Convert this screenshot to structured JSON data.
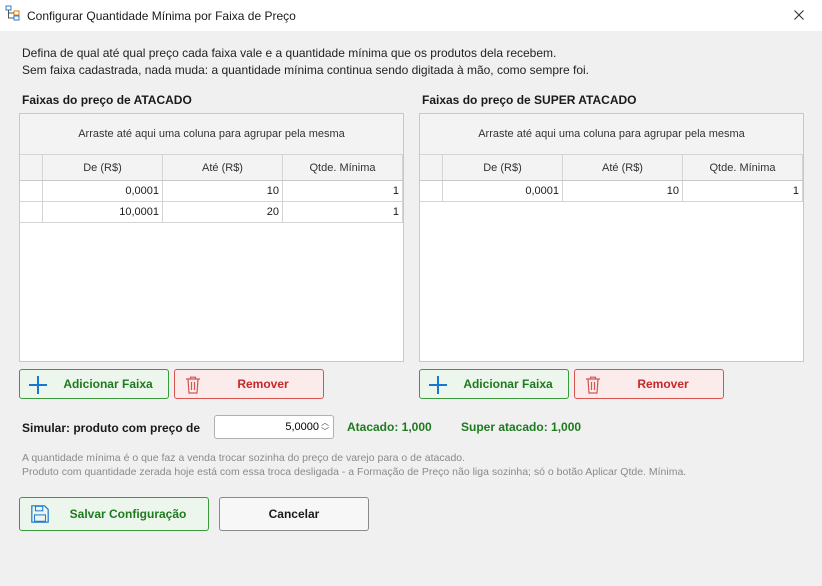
{
  "window": {
    "title": "Configurar Quantidade Mínima por Faixa de Preço",
    "app_icon": "tree-structure-icon",
    "close_icon": "close-icon"
  },
  "description": {
    "line1": "Defina de qual até qual preço cada faixa vale e a quantidade mínima que os produtos dela recebem.",
    "line2": "Sem faixa cadastrada, nada muda: a quantidade mínima continua sendo digitada à mão, como sempre foi."
  },
  "atacado": {
    "title": "Faixas do preço de ATACADO",
    "group_panel": "Arraste até aqui uma coluna para agrupar pela mesma",
    "columns": [
      "De (R$)",
      "Até (R$)",
      "Qtde. Mínima"
    ],
    "rows": [
      {
        "de": "0,0001",
        "ate": "10",
        "qtd": "1"
      },
      {
        "de": "10,0001",
        "ate": "20",
        "qtd": "1"
      }
    ],
    "add_label": "Adicionar Faixa",
    "remove_label": "Remover"
  },
  "super_atacado": {
    "title": "Faixas do preço de SUPER ATACADO",
    "group_panel": "Arraste até aqui uma coluna para agrupar pela mesma",
    "columns": [
      "De (R$)",
      "Até (R$)",
      "Qtde. Mínima"
    ],
    "rows": [
      {
        "de": "0,0001",
        "ate": "10",
        "qtd": "1"
      }
    ],
    "add_label": "Adicionar Faixa",
    "remove_label": "Remover"
  },
  "simulator": {
    "label": "Simular: produto com preço de",
    "value": "5,0000",
    "atacado_result": "Atacado: 1,000",
    "super_result": "Super atacado: 1,000"
  },
  "notes": {
    "line1": "A quantidade mínima é o que faz a venda trocar sozinha do preço de varejo para o de atacado.",
    "line2": "Produto com quantidade zerada hoje está com essa troca desligada - a Formação de Preço não liga sozinha; só o botão Aplicar Qtde. Mínima."
  },
  "footer": {
    "save_label": "Salvar Configuração",
    "cancel_label": "Cancelar"
  },
  "colors": {
    "green": "#1e7a1e",
    "red": "#c62828",
    "accent_blue": "#1976d2"
  }
}
